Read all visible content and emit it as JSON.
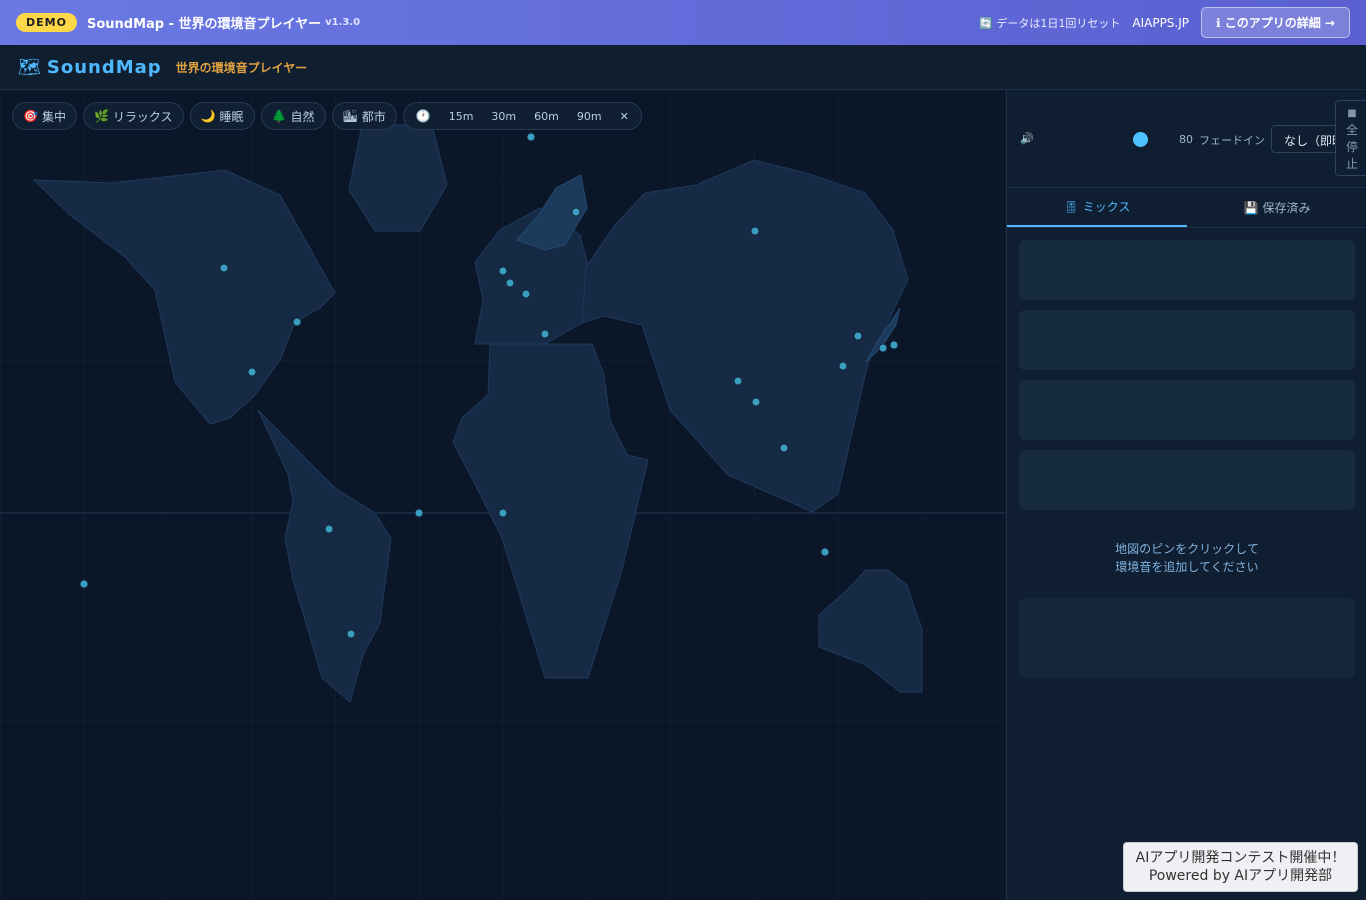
{
  "topbar": {
    "demo_badge": "DEMO",
    "title": "SoundMap - 世界の環境音プレイヤー",
    "version": "v1.3.0",
    "reset_note": "🔄 データは1日1回リセット",
    "aiapps_link": "AIAPPS.JP",
    "detail_button": "ℹ このアプリの詳細 →"
  },
  "header": {
    "logo_icon": "🗺",
    "logo_text": "SoundMap",
    "subtitle": "世界の環境音プレイヤー"
  },
  "filters": {
    "chips": [
      {
        "icon": "🎯",
        "label": "集中"
      },
      {
        "icon": "🌿",
        "label": "リラックス"
      },
      {
        "icon": "🌙",
        "label": "睡眠"
      },
      {
        "icon": "🌲",
        "label": "自然"
      },
      {
        "icon": "🏙",
        "label": "都市"
      }
    ],
    "timer": {
      "icon": "🕐",
      "options": [
        "15m",
        "30m",
        "60m",
        "90m"
      ],
      "clear": "✕"
    }
  },
  "controls": {
    "volume_icon": "🔊",
    "volume_value": "80",
    "fade_label": "フェードイン",
    "fade_selected": "なし（即時）",
    "stop_all": [
      "■",
      "全",
      "停",
      "止"
    ]
  },
  "tabs": [
    {
      "icon": "🎚",
      "label": "ミックス",
      "active": true
    },
    {
      "icon": "💾",
      "label": "保存済み",
      "active": false
    }
  ],
  "hint": {
    "line1": "地図のピンをクリックして",
    "line2": "環境音を追加してください"
  },
  "contest": {
    "line1": "AIアプリ開発コンテスト開催中！",
    "line2": "Powered by AIアプリ開発部"
  },
  "colors": {
    "accent": "#4fb8ff",
    "pin": "#3a9ec0",
    "land": "#162a45",
    "ocean": "#0b1628",
    "demo_badge": "#ffd84a",
    "banner": "#6a79e3"
  }
}
